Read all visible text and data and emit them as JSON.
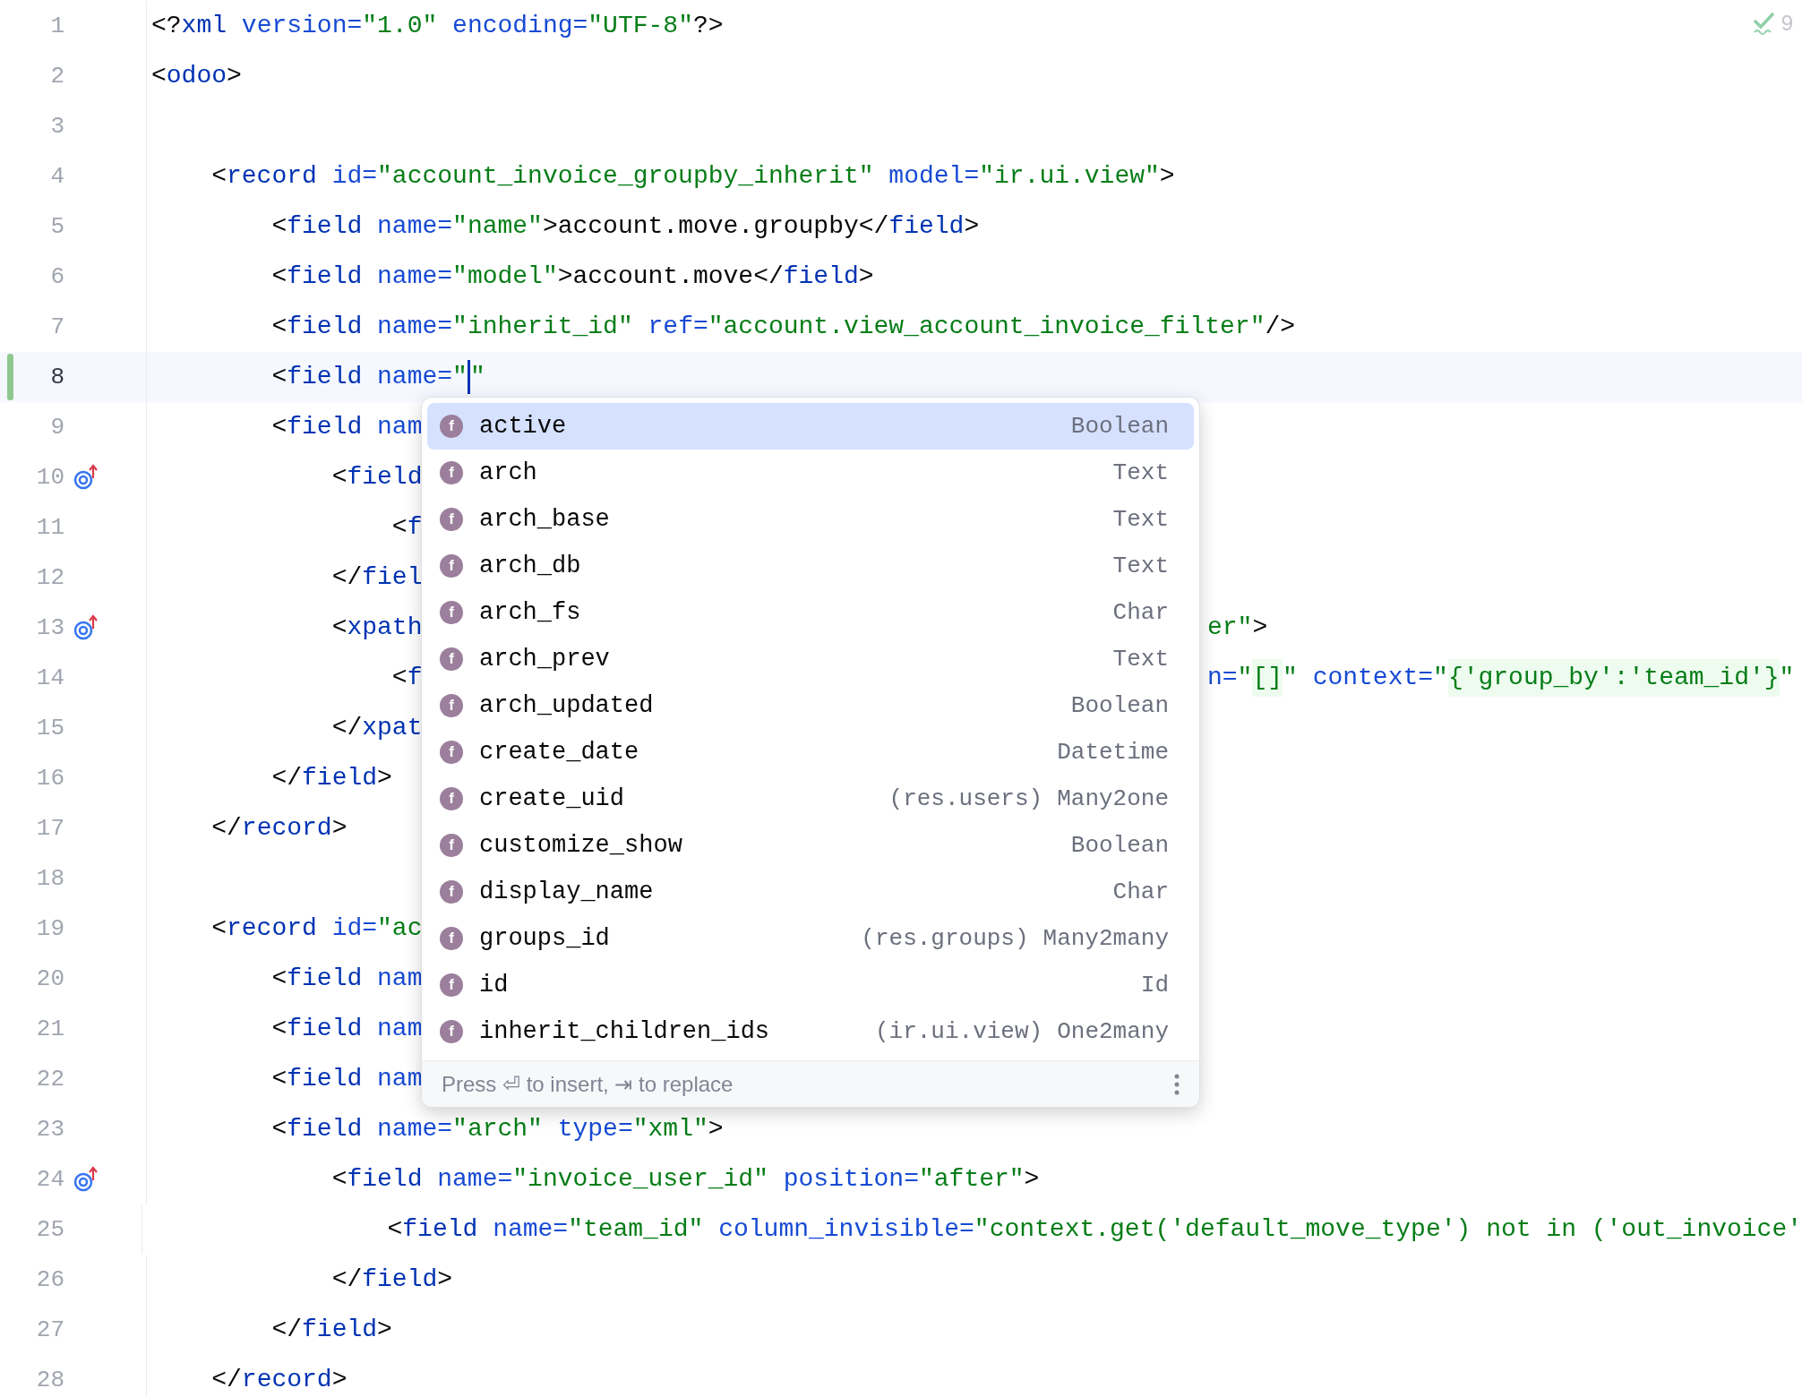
{
  "inspection": {
    "count": "9"
  },
  "lines": [
    {
      "number": "1",
      "tokens": [
        {
          "kind": "p",
          "t": "<?"
        },
        {
          "kind": "tag",
          "t": "xml"
        },
        {
          "kind": "attr",
          "t": " version="
        },
        {
          "kind": "val",
          "t": "\"1.0\""
        },
        {
          "kind": "attr",
          "t": " encoding="
        },
        {
          "kind": "val",
          "t": "\"UTF-8\""
        },
        {
          "kind": "p",
          "t": "?>"
        }
      ]
    },
    {
      "number": "2",
      "tokens": [
        {
          "kind": "p",
          "t": "<"
        },
        {
          "kind": "tag",
          "t": "odoo"
        },
        {
          "kind": "p",
          "t": ">"
        }
      ]
    },
    {
      "number": "3"
    },
    {
      "number": "4",
      "tokens": [
        {
          "kind": "p",
          "t": "    <"
        },
        {
          "kind": "tag",
          "t": "record"
        },
        {
          "kind": "attr",
          "t": " id="
        },
        {
          "kind": "val",
          "t": "\"account_invoice_groupby_inherit\""
        },
        {
          "kind": "attr",
          "t": " model="
        },
        {
          "kind": "val",
          "t": "\"ir.ui.view\""
        },
        {
          "kind": "p",
          "t": ">"
        }
      ]
    },
    {
      "number": "5",
      "tokens": [
        {
          "kind": "p",
          "t": "        <"
        },
        {
          "kind": "tag",
          "t": "field"
        },
        {
          "kind": "attr",
          "t": " name="
        },
        {
          "kind": "val",
          "t": "\"name\""
        },
        {
          "kind": "p",
          "t": ">account.move.groupby</"
        },
        {
          "kind": "tag",
          "t": "field"
        },
        {
          "kind": "p",
          "t": ">"
        }
      ]
    },
    {
      "number": "6",
      "tokens": [
        {
          "kind": "p",
          "t": "        <"
        },
        {
          "kind": "tag",
          "t": "field"
        },
        {
          "kind": "attr",
          "t": " name="
        },
        {
          "kind": "val",
          "t": "\"model\""
        },
        {
          "kind": "p",
          "t": ">account.move</"
        },
        {
          "kind": "tag",
          "t": "field"
        },
        {
          "kind": "p",
          "t": ">"
        }
      ]
    },
    {
      "number": "7",
      "tokens": [
        {
          "kind": "p",
          "t": "        <"
        },
        {
          "kind": "tag",
          "t": "field"
        },
        {
          "kind": "attr",
          "t": " name="
        },
        {
          "kind": "val",
          "t": "\"inherit_id\""
        },
        {
          "kind": "attr",
          "t": " ref="
        },
        {
          "kind": "val",
          "t": "\"account.view_account_invoice_filter\""
        },
        {
          "kind": "p",
          "t": "/>"
        }
      ]
    },
    {
      "number": "8",
      "current": true,
      "changed": true,
      "tokens": [
        {
          "kind": "p",
          "t": "        <"
        },
        {
          "kind": "tag",
          "t": "field"
        },
        {
          "kind": "attr",
          "t": " name="
        },
        {
          "kind": "val",
          "t": "\""
        },
        {
          "kind": "caret"
        },
        {
          "kind": "val",
          "t": "\""
        }
      ]
    },
    {
      "number": "9",
      "tokens": [
        {
          "kind": "p",
          "t": "        <"
        },
        {
          "kind": "tag",
          "t": "field"
        },
        {
          "kind": "attr",
          "t": " nam"
        }
      ]
    },
    {
      "number": "10",
      "gutter": {
        "kind": "override"
      },
      "tokens": [
        {
          "kind": "p",
          "t": "            <"
        },
        {
          "kind": "tag",
          "t": "field"
        }
      ]
    },
    {
      "number": "11",
      "tokens": [
        {
          "kind": "p",
          "t": "                <"
        },
        {
          "kind": "tag",
          "t": "f"
        }
      ]
    },
    {
      "number": "12",
      "tokens": [
        {
          "kind": "p",
          "t": "            </"
        },
        {
          "kind": "tag",
          "t": "fiel"
        }
      ]
    },
    {
      "number": "13",
      "gutter": {
        "kind": "override"
      },
      "tokens": [
        {
          "kind": "p",
          "t": "            <"
        },
        {
          "kind": "tag",
          "t": "xpath"
        }
      ],
      "right": [
        {
          "kind": "val",
          "t": "er\""
        },
        {
          "kind": "p",
          "t": ">"
        }
      ]
    },
    {
      "number": "14",
      "tokens": [
        {
          "kind": "p",
          "t": "                <"
        },
        {
          "kind": "tag",
          "t": "f"
        }
      ],
      "right": [
        {
          "kind": "attr",
          "t": "n="
        },
        {
          "kind": "val",
          "t": "\""
        },
        {
          "kind": "inj",
          "t": "[]"
        },
        {
          "kind": "val",
          "t": "\""
        },
        {
          "kind": "attr",
          "t": " context="
        },
        {
          "kind": "val",
          "t": "\""
        },
        {
          "kind": "inj",
          "t": "{'group_by':'team_id'}"
        },
        {
          "kind": "val",
          "t": "\""
        }
      ]
    },
    {
      "number": "15",
      "tokens": [
        {
          "kind": "p",
          "t": "            </"
        },
        {
          "kind": "tag",
          "t": "xpat"
        }
      ]
    },
    {
      "number": "16",
      "tokens": [
        {
          "kind": "p",
          "t": "        </"
        },
        {
          "kind": "tag",
          "t": "field"
        },
        {
          "kind": "p",
          "t": ">"
        }
      ]
    },
    {
      "number": "17",
      "tokens": [
        {
          "kind": "p",
          "t": "    </"
        },
        {
          "kind": "tag",
          "t": "record"
        },
        {
          "kind": "p",
          "t": ">"
        }
      ]
    },
    {
      "number": "18"
    },
    {
      "number": "19",
      "tokens": [
        {
          "kind": "p",
          "t": "    <"
        },
        {
          "kind": "tag",
          "t": "record"
        },
        {
          "kind": "attr",
          "t": " id="
        },
        {
          "kind": "val",
          "t": "\"ac"
        }
      ]
    },
    {
      "number": "20",
      "tokens": [
        {
          "kind": "p",
          "t": "        <"
        },
        {
          "kind": "tag",
          "t": "field"
        },
        {
          "kind": "attr",
          "t": " nam"
        }
      ]
    },
    {
      "number": "21",
      "tokens": [
        {
          "kind": "p",
          "t": "        <"
        },
        {
          "kind": "tag",
          "t": "field"
        },
        {
          "kind": "attr",
          "t": " nam"
        }
      ]
    },
    {
      "number": "22",
      "tokens": [
        {
          "kind": "p",
          "t": "        <"
        },
        {
          "kind": "tag",
          "t": "field"
        },
        {
          "kind": "attr",
          "t": " nam"
        }
      ]
    },
    {
      "number": "23",
      "tokens": [
        {
          "kind": "p",
          "t": "        <"
        },
        {
          "kind": "tag",
          "t": "field"
        },
        {
          "kind": "attr",
          "t": " name="
        },
        {
          "kind": "val",
          "t": "\"arch\""
        },
        {
          "kind": "attr",
          "t": " type="
        },
        {
          "kind": "val",
          "t": "\"xml\""
        },
        {
          "kind": "p",
          "t": ">"
        }
      ]
    },
    {
      "number": "24",
      "gutter": {
        "kind": "override"
      },
      "tokens": [
        {
          "kind": "p",
          "t": "            <"
        },
        {
          "kind": "tag",
          "t": "field"
        },
        {
          "kind": "attr",
          "t": " name="
        },
        {
          "kind": "val",
          "t": "\"invoice_user_id\""
        },
        {
          "kind": "attr",
          "t": " position="
        },
        {
          "kind": "val",
          "t": "\"after\""
        },
        {
          "kind": "p",
          "t": ">"
        }
      ]
    },
    {
      "number": "25",
      "tokens": [
        {
          "kind": "p",
          "t": "                <"
        },
        {
          "kind": "tag",
          "t": "field"
        },
        {
          "kind": "attr",
          "t": " name="
        },
        {
          "kind": "val",
          "t": "\"team_id\""
        },
        {
          "kind": "attr",
          "t": " column_invisible="
        },
        {
          "kind": "val",
          "t": "\"context.get('default_move_type') not in ('out_invoice'"
        }
      ]
    },
    {
      "number": "26",
      "tokens": [
        {
          "kind": "p",
          "t": "            </"
        },
        {
          "kind": "tag",
          "t": "field"
        },
        {
          "kind": "p",
          "t": ">"
        }
      ]
    },
    {
      "number": "27",
      "tokens": [
        {
          "kind": "p",
          "t": "        </"
        },
        {
          "kind": "tag",
          "t": "field"
        },
        {
          "kind": "p",
          "t": ">"
        }
      ]
    },
    {
      "number": "28",
      "tokens": [
        {
          "kind": "p",
          "t": "    </"
        },
        {
          "kind": "tag",
          "t": "record"
        },
        {
          "kind": "p",
          "t": ">"
        }
      ]
    }
  ],
  "completion": {
    "items": [
      {
        "badge": "f",
        "name": "active",
        "type": "Boolean",
        "selected": true
      },
      {
        "badge": "f",
        "name": "arch",
        "type": "Text",
        "selected": false
      },
      {
        "badge": "f",
        "name": "arch_base",
        "type": "Text",
        "selected": false
      },
      {
        "badge": "f",
        "name": "arch_db",
        "type": "Text",
        "selected": false
      },
      {
        "badge": "f",
        "name": "arch_fs",
        "type": "Char",
        "selected": false
      },
      {
        "badge": "f",
        "name": "arch_prev",
        "type": "Text",
        "selected": false
      },
      {
        "badge": "f",
        "name": "arch_updated",
        "type": "Boolean",
        "selected": false
      },
      {
        "badge": "f",
        "name": "create_date",
        "type": "Datetime",
        "selected": false
      },
      {
        "badge": "f",
        "name": "create_uid",
        "model": "(res.users)",
        "type": "Many2one",
        "selected": false
      },
      {
        "badge": "f",
        "name": "customize_show",
        "type": "Boolean",
        "selected": false
      },
      {
        "badge": "f",
        "name": "display_name",
        "type": "Char",
        "selected": false
      },
      {
        "badge": "f",
        "name": "groups_id",
        "model": "(res.groups)",
        "type": "Many2many",
        "selected": false
      },
      {
        "badge": "f",
        "name": "id",
        "type": "Id",
        "selected": false
      },
      {
        "badge": "f",
        "name": "inherit_children_ids",
        "model": "(ir.ui.view)",
        "type": "One2many",
        "selected": false
      }
    ],
    "hint": "Press ⏎ to insert, ⇥ to replace"
  }
}
